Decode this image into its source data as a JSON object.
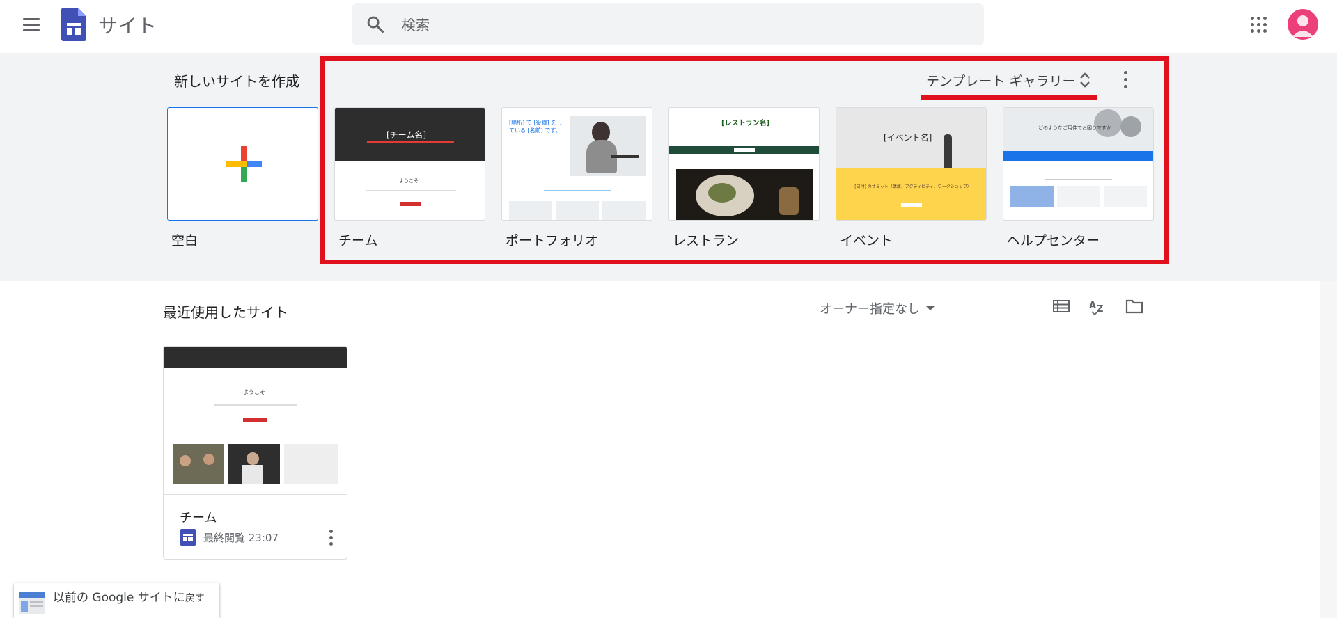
{
  "app": {
    "title": "サイト"
  },
  "search": {
    "placeholder": "検索"
  },
  "template_gallery": {
    "title": "新しいサイトを作成",
    "toggle_label": "テンプレート ギャラリー",
    "tiles": [
      {
        "name": "空白"
      },
      {
        "name": "チーム",
        "thumb_heading": "[チーム名]",
        "thumb_welcome": "ようこそ"
      },
      {
        "name": "ポートフォリオ",
        "thumb_heading": "[場所] で [役職] をしている [名前] です。"
      },
      {
        "name": "レストラン",
        "thumb_heading": "[レストラン名]"
      },
      {
        "name": "イベント",
        "thumb_heading": "[イベント名]",
        "thumb_sub": "[日付] のサミット（講演、アクティビティ、ワークショップ）"
      },
      {
        "name": "ヘルプセンター",
        "thumb_heading": "どのようなご用件でお困りですか"
      }
    ]
  },
  "recent": {
    "title": "最近使用したサイト",
    "owner_filter": "オーナー指定なし",
    "view_icons": [
      "list-view-icon",
      "sort-az-icon",
      "folder-icon"
    ],
    "sites": [
      {
        "name": "チーム",
        "last_viewed": "最終閲覧 23:07",
        "thumb_welcome": "ようこそ"
      }
    ]
  },
  "classic_link": {
    "label_main": "以前の Google サイトに",
    "label_tail": "戻す"
  },
  "colors": {
    "highlight": "#e0111d",
    "brand": "#4050b5",
    "avatar": "#ec407a",
    "band": "#f1f3f4"
  }
}
